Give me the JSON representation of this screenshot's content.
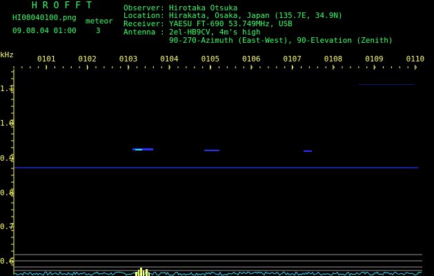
{
  "header": {
    "program": "HROFFT",
    "filename": "HI08040100.png",
    "datetime": "09.08.04 01:00",
    "meteor_label": "meteor",
    "meteor_count": "3",
    "observer_key": "Observer",
    "observer_val": "Hirotaka Otsuka",
    "location_key": "Location",
    "location_val": "Hirakata, Osaka, Japan (135.7E, 34.9N)",
    "receiver_key": "Receiver",
    "receiver_val": "YAESU FT-690 53.749MHz, USB",
    "antenna_key": "Antenna",
    "antenna_val1": "2el-HB9CV, 4m's high",
    "antenna_val2": "90-270-Azimuth (East-West), 90-Elevation (Zenith)"
  },
  "spectrogram": {
    "y_unit": "kHz",
    "y_ticks": [
      "1.1",
      "1.0",
      "0.9",
      "0.8",
      "0.7",
      "0.6"
    ],
    "time_ticks": [
      "0101",
      "0102",
      "0103",
      "0104",
      "0105",
      "0106",
      "0107",
      "0108",
      "0109",
      "0110"
    ],
    "colors": {
      "label": "#ffff66",
      "title": "#33ff66",
      "trace": "#2233ff",
      "noise": "#33ddff"
    }
  }
}
